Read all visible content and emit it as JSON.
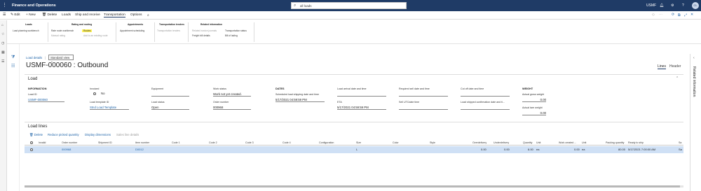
{
  "topbar": {
    "app_title": "Finance and Operations",
    "search_value": "all loads",
    "company": "USMF",
    "avatar": "CL"
  },
  "actions": {
    "edit": "Edit",
    "new": "New",
    "delete": "Delete",
    "loads": "Loads",
    "ship_receive": "Ship and receive",
    "transportation": "Transportation",
    "options": "Options"
  },
  "ribbon": {
    "loads": {
      "title": "Loads",
      "items": [
        "Load planning workbench"
      ]
    },
    "rating": {
      "title": "Rating and routing",
      "items": [
        "Rate route workbench",
        "Manual rating",
        "Routes",
        "Add to an existing route"
      ]
    },
    "appointments": {
      "title": "Appointments",
      "items": [
        "Appointment scheduling"
      ]
    },
    "tenders": {
      "title": "Transportation tenders",
      "items": [
        "Transportation tenders"
      ]
    },
    "related": {
      "title": "Related information",
      "items": [
        "Related invoice journals",
        "Freight bill details",
        "Transportation status",
        "Bill of lading"
      ]
    }
  },
  "header": {
    "breadcrumb": "Load details",
    "view": "Standard view",
    "title": "USMF-000060 : Outbound",
    "tab_lines": "Lines",
    "tab_header": "Header",
    "related_pane": "Related information"
  },
  "load": {
    "section_title": "Load",
    "information_label": "INFORMATION",
    "load_id_label": "Load ID",
    "load_id": "USMF-000060",
    "invoiced_label": "Invoiced",
    "invoiced": "No",
    "template_label": "Load template ID",
    "template": "Stnd Load Template",
    "equipment_label": "Equipment",
    "equipment": "",
    "status_label": "Load status",
    "status": "Open",
    "work_status_label": "Work status",
    "work_status": "Work not yet created.",
    "order_label": "Order number",
    "order": "000968",
    "dates_label": "DATES",
    "sched_label": "Scheduled load shipping date and time",
    "sched": "5/17/2021 04:59:59 PM",
    "eta_label": "ETA",
    "arrival_label": "Load arrival date and time",
    "eta_val": "5/17/2021 04:59:59 PM",
    "req_sell_label": "Required sell date and time",
    "sell_utc_label": "Sell UTCdate time",
    "cutoff_label": "Cut off date and time",
    "confirm_label": "Load shipped confirmation date and ti...",
    "weight_label": "WEIGHT",
    "gross_label": "Actual gross weight",
    "gross": "0.00",
    "tare_label": "Actual tare weight",
    "tare": "0.00"
  },
  "lines": {
    "section_title": "Load lines",
    "toolbar": {
      "delete": "Delete",
      "reduce": "Reduce picked quantity",
      "dims": "Display dimensions",
      "sales": "Sales line details"
    },
    "columns": [
      "Invalid",
      "Order number",
      "Shipment ID",
      "Item number",
      "Code 1",
      "Code 2",
      "Code 3",
      "Code 4",
      "Configuration",
      "Size",
      "Color",
      "Style",
      "Overdelivery",
      "Underdelivery",
      "Quantity",
      "Unit",
      "Work created ...",
      "Unit",
      "Packing quantity",
      "Ready to ship",
      "Sa"
    ],
    "row": {
      "order": "000968",
      "shipment": "",
      "item": "D0012",
      "size": "L",
      "over": "0.00",
      "under": "0.00",
      "qty": "6.00",
      "unit": "ea",
      "work": "0.00",
      "unit2": "ea",
      "packing": "80.00",
      "ready": "5/17/2021 7:00:00 AM",
      "sa": "Sa"
    }
  }
}
